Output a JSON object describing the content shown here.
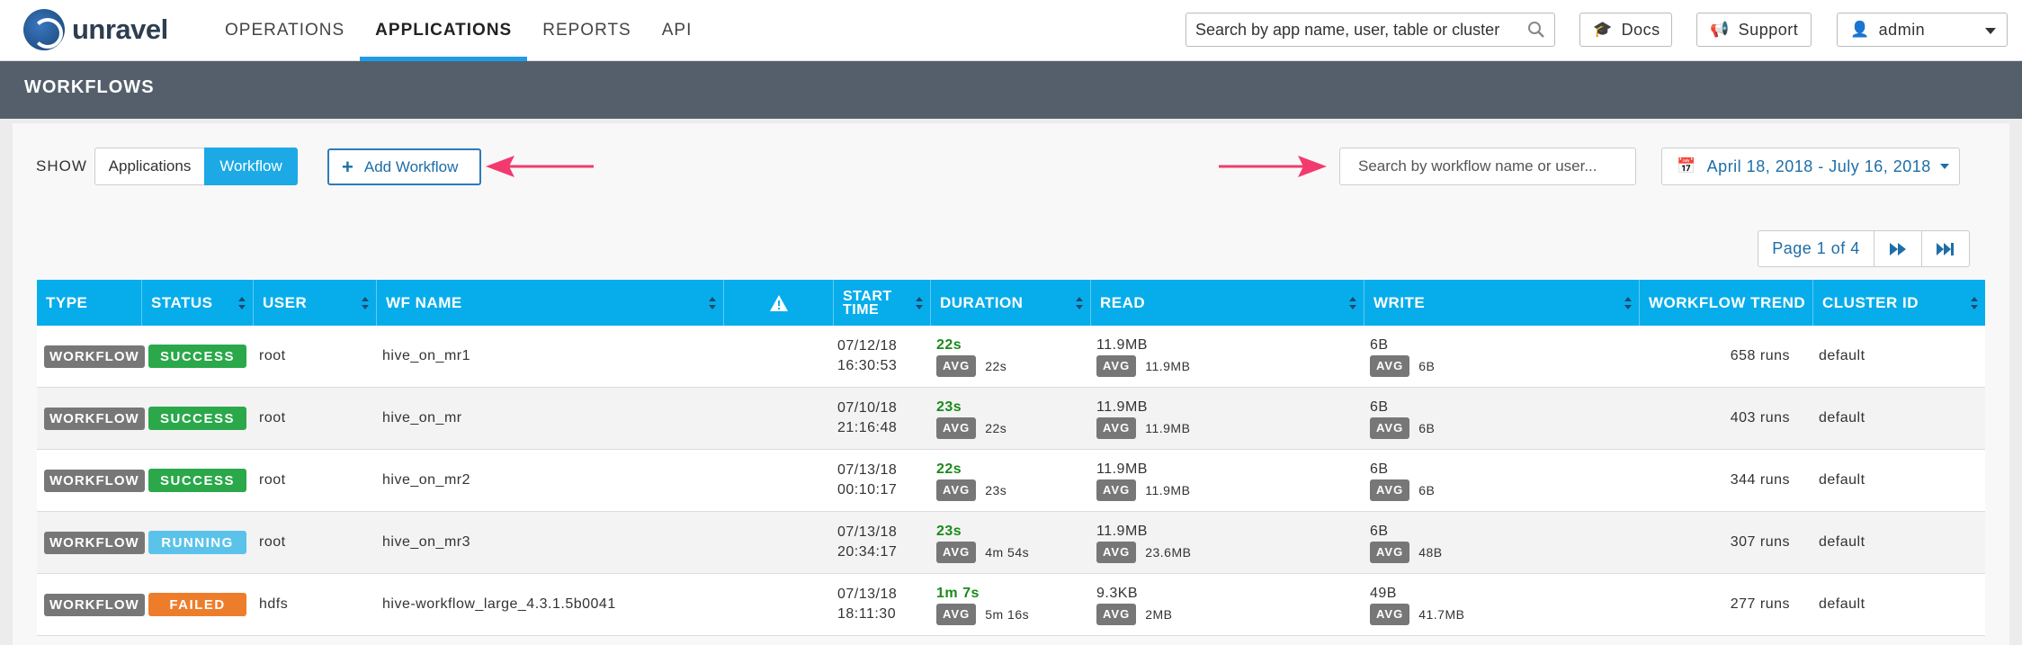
{
  "app": {
    "logo_text": "unravel"
  },
  "nav": {
    "items": [
      {
        "label": "OPERATIONS",
        "active": false
      },
      {
        "label": "APPLICATIONS",
        "active": true
      },
      {
        "label": "REPORTS",
        "active": false
      },
      {
        "label": "API",
        "active": false
      }
    ]
  },
  "global_search": {
    "placeholder": "Search by app name, user, table or cluster"
  },
  "header_buttons": {
    "docs": "Docs",
    "support": "Support",
    "user": "admin"
  },
  "section": {
    "title": "WORKFLOWS"
  },
  "filters": {
    "show_label": "SHOW",
    "toggle": {
      "applications": "Applications",
      "workflow": "Workflow",
      "selected": "Workflow"
    },
    "add_workflow": "Add Workflow",
    "search_placeholder": "Search by workflow name or user...",
    "date_range": "April 18, 2018 - July 16, 2018"
  },
  "pager": {
    "label": "Page 1 of 4"
  },
  "colors": {
    "accent": "#07adeb",
    "success": "#2aa84a",
    "running": "#5bc3ea",
    "failed": "#ee7d2b",
    "annotation_arrow": "#f23a6e"
  },
  "table": {
    "headers": {
      "type": "TYPE",
      "status": "STATUS",
      "user": "USER",
      "wf_name": "WF NAME",
      "start_time_1": "START",
      "start_time_2": "TIME",
      "duration": "DURATION",
      "read": "READ",
      "write": "WRITE",
      "trend": "WORKFLOW TREND",
      "cluster": "CLUSTER ID"
    },
    "avg_label": "AVG",
    "rows": [
      {
        "type": "WORKFLOW",
        "status": "SUCCESS",
        "status_color": "#2aa84a",
        "user": "root",
        "wf_name": "hive_on_mr1",
        "date": "07/12/18",
        "time": "16:30:53",
        "duration": "22s",
        "duration_avg": "22s",
        "read": "11.9MB",
        "read_avg": "11.9MB",
        "write": "6B",
        "write_avg": "6B",
        "trend": "658 runs",
        "cluster": "default"
      },
      {
        "type": "WORKFLOW",
        "status": "SUCCESS",
        "status_color": "#2aa84a",
        "user": "root",
        "wf_name": "hive_on_mr",
        "date": "07/10/18",
        "time": "21:16:48",
        "duration": "23s",
        "duration_avg": "22s",
        "read": "11.9MB",
        "read_avg": "11.9MB",
        "write": "6B",
        "write_avg": "6B",
        "trend": "403 runs",
        "cluster": "default"
      },
      {
        "type": "WORKFLOW",
        "status": "SUCCESS",
        "status_color": "#2aa84a",
        "user": "root",
        "wf_name": "hive_on_mr2",
        "date": "07/13/18",
        "time": "00:10:17",
        "duration": "22s",
        "duration_avg": "23s",
        "read": "11.9MB",
        "read_avg": "11.9MB",
        "write": "6B",
        "write_avg": "6B",
        "trend": "344 runs",
        "cluster": "default"
      },
      {
        "type": "WORKFLOW",
        "status": "RUNNING",
        "status_color": "#5bc3ea",
        "user": "root",
        "wf_name": "hive_on_mr3",
        "date": "07/13/18",
        "time": "20:34:17",
        "duration": "23s",
        "duration_avg": "4m 54s",
        "read": "11.9MB",
        "read_avg": "23.6MB",
        "write": "6B",
        "write_avg": "48B",
        "trend": "307 runs",
        "cluster": "default"
      },
      {
        "type": "WORKFLOW",
        "status": "FAILED",
        "status_color": "#ee7d2b",
        "user": "hdfs",
        "wf_name": "hive-workflow_large_4.3.1.5b0041",
        "date": "07/13/18",
        "time": "18:11:30",
        "duration": "1m 7s",
        "duration_avg": "5m 16s",
        "read": "9.3KB",
        "read_avg": "2MB",
        "write": "49B",
        "write_avg": "41.7MB",
        "trend": "277 runs",
        "cluster": "default"
      }
    ]
  }
}
